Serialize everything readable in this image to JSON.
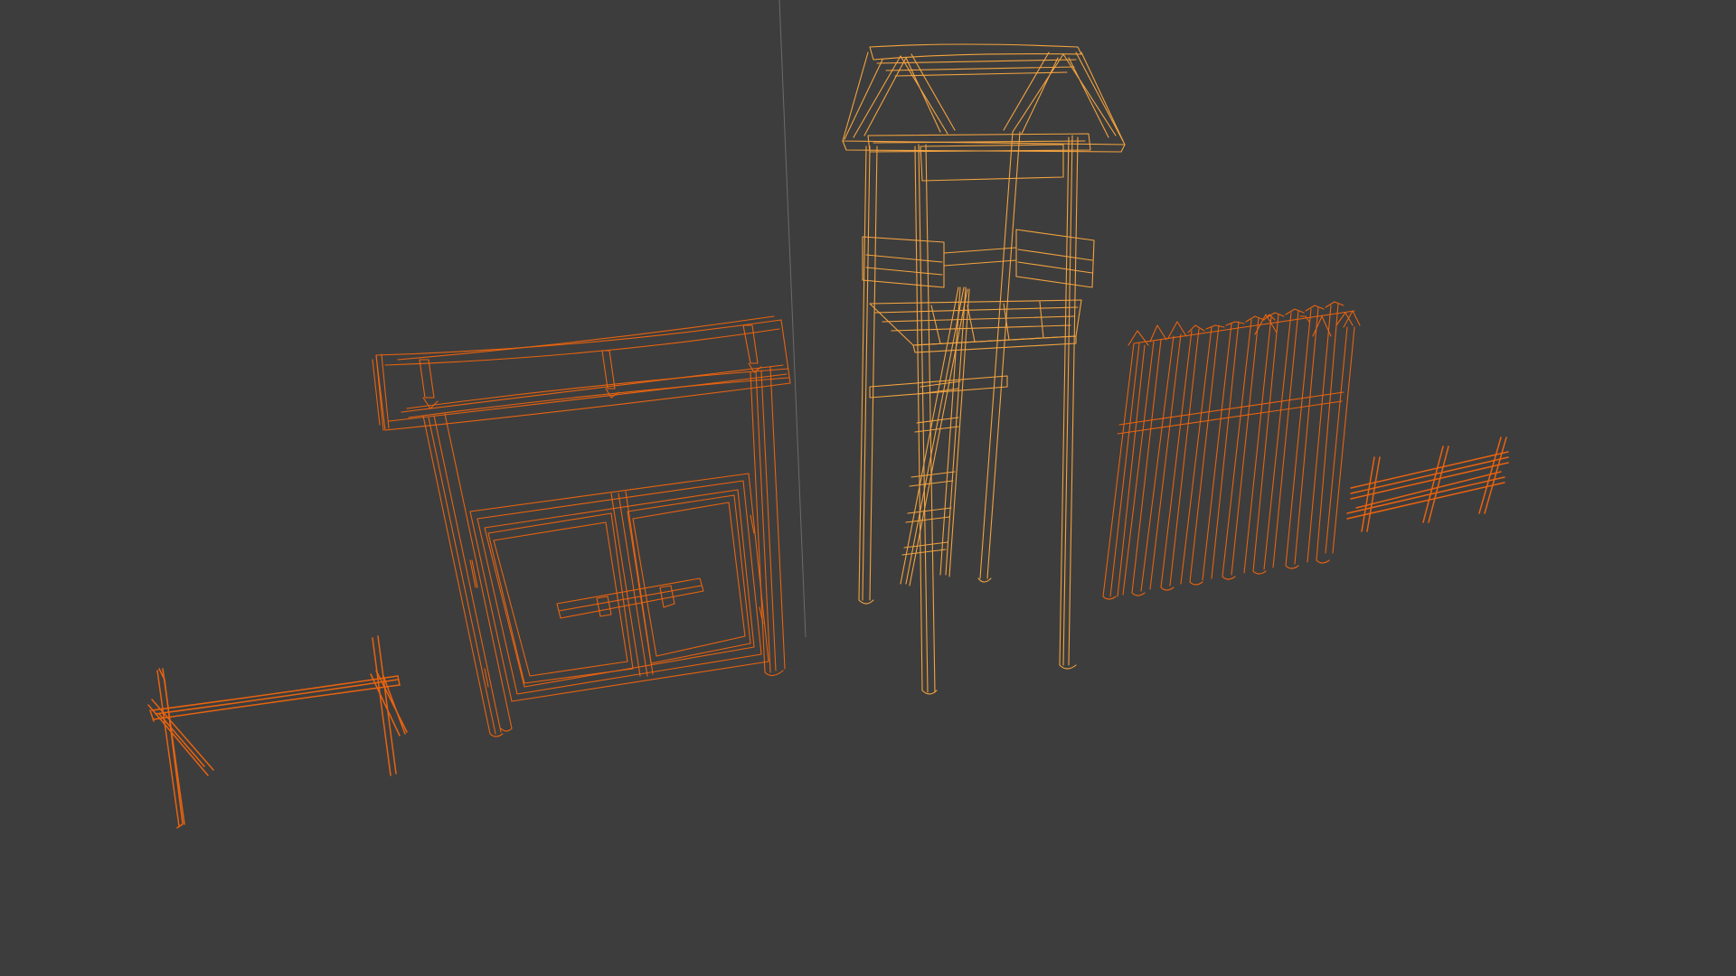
{
  "scene": {
    "background_color": "#3d3d3d",
    "view_mode": "wireframe",
    "selected_color": "#e8630f",
    "active_color": "#f3a33f",
    "axis_line_color": "#6b6b6b"
  },
  "objects": [
    {
      "name": "sawhorse-barrier",
      "state": "selected"
    },
    {
      "name": "gate",
      "state": "selected"
    },
    {
      "name": "watchtower",
      "state": "active"
    },
    {
      "name": "palisade-wall",
      "state": "selected"
    },
    {
      "name": "small-fence",
      "state": "selected"
    }
  ]
}
